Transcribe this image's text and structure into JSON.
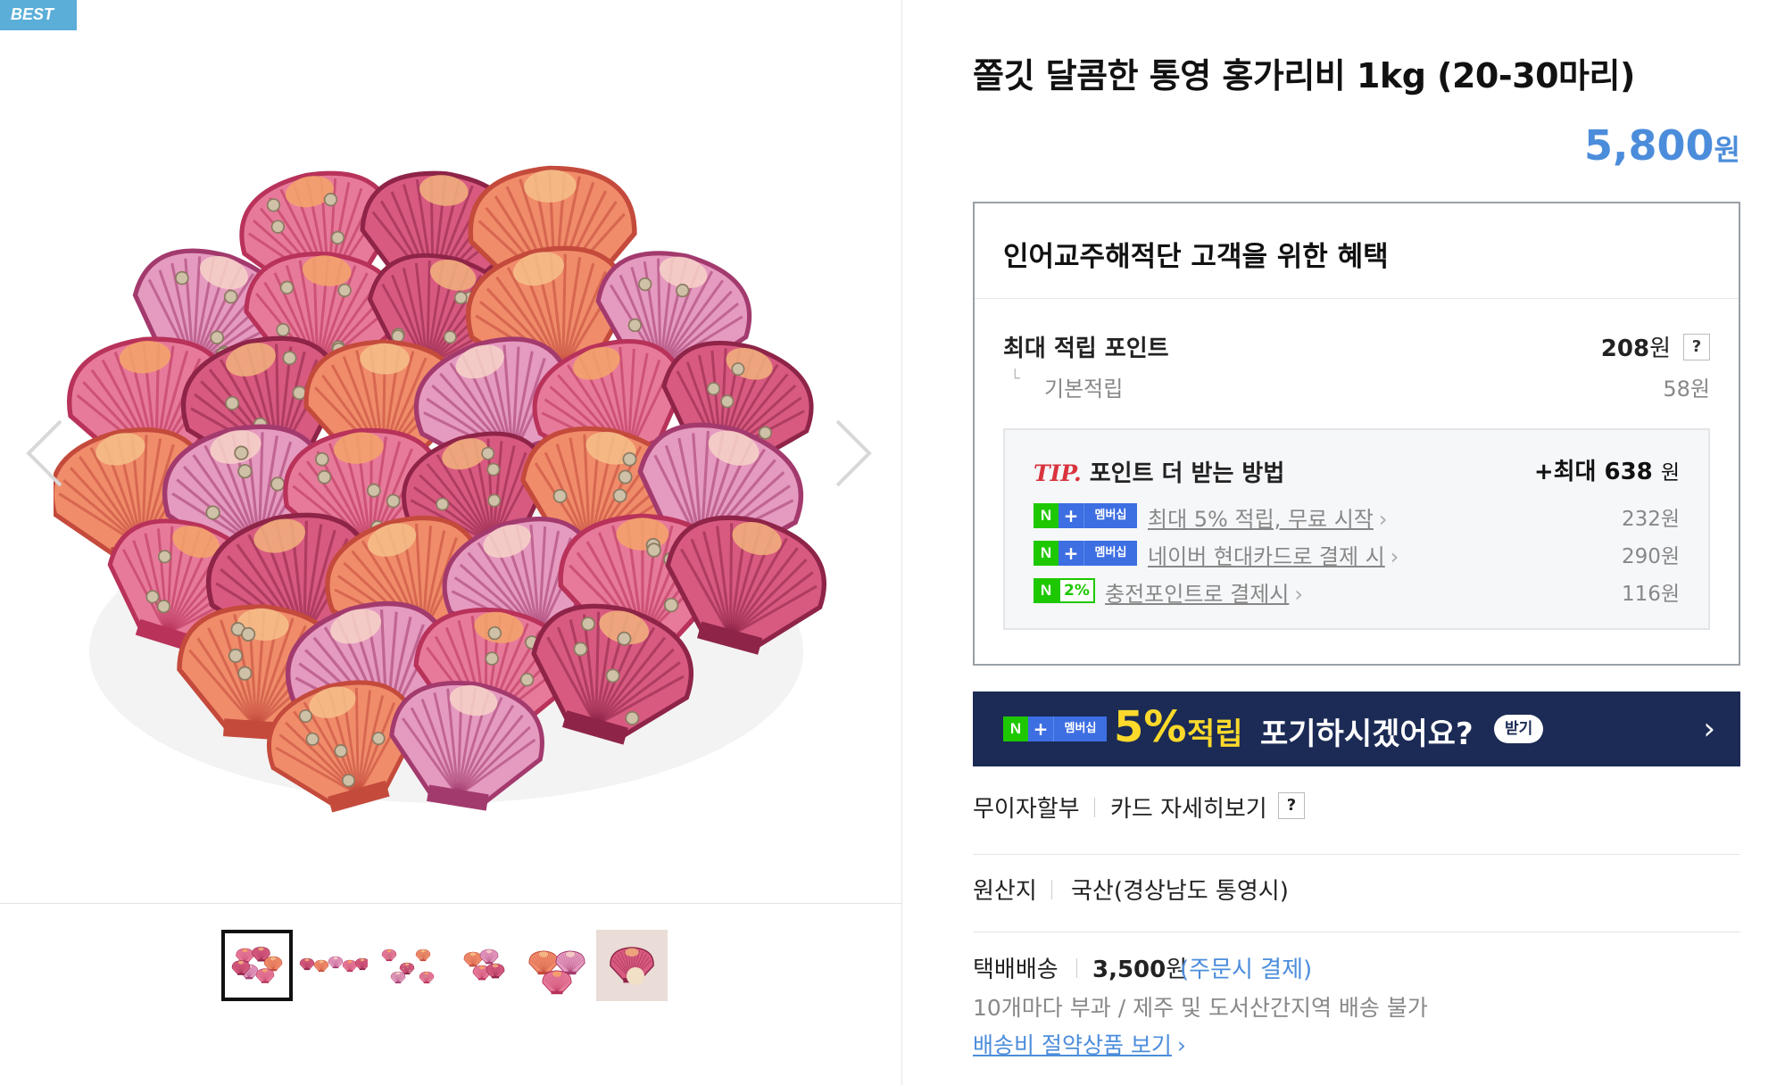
{
  "badge": "BEST",
  "product": {
    "title": "쫄깃 달콤한 통영 홍가리비 1kg (20-30마리)",
    "price": "5,800",
    "price_unit": "원"
  },
  "gallery": {
    "thumbnail_count": 6,
    "active_index": 0
  },
  "benefits": {
    "title": "인어교주해적단 고객을 위한 혜택",
    "max_points_label": "최대 적립 포인트",
    "max_points_value": "208",
    "max_points_unit": "원",
    "help": "?",
    "basic_label": "기본적립",
    "basic_value": "58원",
    "tip": {
      "prefix": "TIP.",
      "heading": "포인트 더 받는 방법",
      "max_label": "+최대 638",
      "max_unit": "원",
      "rows": [
        {
          "badge": "membership",
          "text": "최대 5% 적립, 무료 시작",
          "value": "232원"
        },
        {
          "badge": "membership",
          "text": "네이버 현대카드로 결제 시",
          "value": "290원"
        },
        {
          "badge": "charge",
          "text": "충전포인트로 결제시",
          "value": "116원"
        }
      ],
      "badge_n": "N",
      "badge_plus": "+",
      "badge_membership": "멤버십",
      "badge_pct": "2%"
    }
  },
  "banner": {
    "percent": "5%",
    "accrue": "적립",
    "text": "포기하시겠어요?",
    "pill": "받기",
    "chevron": "›"
  },
  "installment": {
    "label": "무이자할부",
    "card_link": "카드 자세히보기",
    "help": "?"
  },
  "origin": {
    "label": "원산지",
    "value": "국산(경상남도 통영시)"
  },
  "shipping": {
    "label": "택배배송",
    "fee": "3,500",
    "fee_unit": "원",
    "note": "(주문시 결제)",
    "line2": "10개마다 부과 / 제주 및 도서산간지역 배송 불가",
    "link": "배송비 절약상품 보기",
    "chevron": "›"
  },
  "colors": {
    "accent_blue": "#4c8ddb",
    "banner_bg": "#1b2b55",
    "naver_green": "#1ec800",
    "tip_red": "#d8343e",
    "banner_yellow": "#fcd92b"
  },
  "icons": [
    "arrow-left-icon",
    "arrow-right-icon",
    "chevron-right-icon",
    "help-icon"
  ]
}
